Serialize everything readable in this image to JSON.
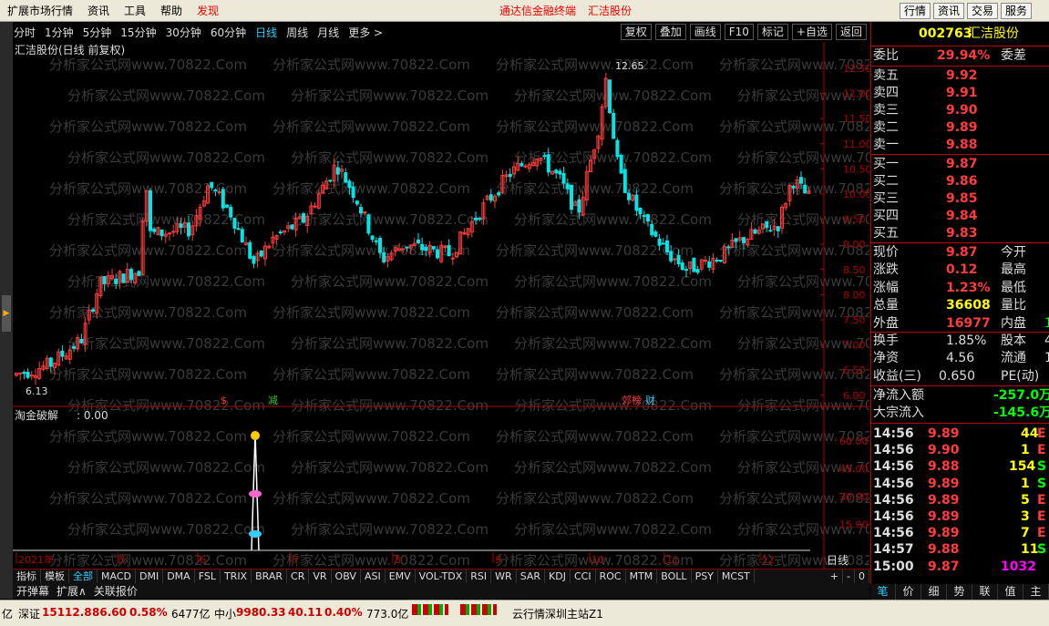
{
  "menubar": {
    "items": [
      "扩展市场行情",
      "资讯",
      "工具",
      "帮助",
      "发现"
    ],
    "center_app": "通达信金融终端",
    "center_stock": "汇洁股份",
    "right_buttons": [
      "行情",
      "资讯",
      "交易",
      "服务"
    ]
  },
  "periods": [
    "分时",
    "1分钟",
    "5分钟",
    "15分钟",
    "30分钟",
    "60分钟",
    "日线",
    "周线",
    "月线",
    "更多 >"
  ],
  "active_period": "日线",
  "tools": [
    "复权",
    "叠加",
    "画线",
    "F10",
    "标记",
    "+自选",
    "返回"
  ],
  "chart": {
    "title": "汇洁股份(日线 前复权)",
    "y_ticks": [
      "12.50",
      "12.00",
      "11.50",
      "11.00",
      "10.50",
      "10.00",
      "9.50",
      "9.00",
      "8.50",
      "8.00",
      "7.50",
      "7.00",
      "6.50",
      "6.00"
    ],
    "high_label": "12.65",
    "low_label": "6.13",
    "markers": [
      "$",
      "减",
      "郊榜",
      "财"
    ],
    "watermark": "分析家公式网www.70822.Com",
    "colors": {
      "up": "#ff3c3c",
      "down": "#00e5e5",
      "axis": "#b00000"
    }
  },
  "indicator": {
    "title": "淘金破解",
    "value": ": 0.00",
    "y_ticks": [
      "60.00",
      "45.00",
      "30.00",
      "15.00"
    ],
    "x_labels": [
      "2021年",
      "5",
      "6",
      "7",
      "8",
      "9",
      "10",
      "11",
      "12"
    ],
    "period_label": "日线"
  },
  "btabs": [
    "指标",
    "模板",
    "全部",
    "MACD",
    "DMI",
    "DMA",
    "FSL",
    "TRIX",
    "BRAR",
    "CR",
    "VR",
    "OBV",
    "ASI",
    "EMV",
    "VOL-TDX",
    "RSI",
    "WR",
    "SAR",
    "KDJ",
    "CCI",
    "ROC",
    "MTM",
    "BOLL",
    "PSY",
    "MCST"
  ],
  "btabs_active": "全部",
  "btabs_right": [
    "+",
    "-",
    "0"
  ],
  "btabs2": [
    "开弹幕",
    "扩展∧",
    "关联报价"
  ],
  "quote": {
    "code": "002763",
    "name": "汇洁股份",
    "weibi_label": "委比",
    "weibi": "29.94%",
    "weicha_label": "委差",
    "asks": [
      {
        "l": "卖五",
        "v": "9.92"
      },
      {
        "l": "卖四",
        "v": "9.91"
      },
      {
        "l": "卖三",
        "v": "9.90"
      },
      {
        "l": "卖二",
        "v": "9.89"
      },
      {
        "l": "卖一",
        "v": "9.88"
      }
    ],
    "bids": [
      {
        "l": "买一",
        "v": "9.87"
      },
      {
        "l": "买二",
        "v": "9.86"
      },
      {
        "l": "买三",
        "v": "9.85"
      },
      {
        "l": "买四",
        "v": "9.84"
      },
      {
        "l": "买五",
        "v": "9.83"
      }
    ],
    "stats": [
      {
        "l": "现价",
        "v": "9.87",
        "r": "今开"
      },
      {
        "l": "涨跌",
        "v": "0.12",
        "r": "最高"
      },
      {
        "l": "涨幅",
        "v": "1.23%",
        "r": "最低"
      },
      {
        "l": "总量",
        "v": "36608",
        "r": "量比"
      },
      {
        "l": "外盘",
        "v": "16977",
        "r": "内盘",
        "x": "1"
      }
    ],
    "stats2": [
      {
        "l": "换手",
        "v": "1.85%",
        "r": "股本",
        "x": "4"
      },
      {
        "l": "净资",
        "v": "4.56",
        "r": "流通",
        "x": "1"
      },
      {
        "l": "收益(三)",
        "v": "0.650",
        "r": "PE(动)"
      }
    ],
    "flows": [
      {
        "l": "净流入额",
        "v": "-257.0万"
      },
      {
        "l": "大宗流入",
        "v": "-145.6万"
      }
    ],
    "ticks": [
      {
        "t": "14:56",
        "p": "9.89",
        "v": "44",
        "s": "E"
      },
      {
        "t": "14:56",
        "p": "9.90",
        "v": "1",
        "s": "E"
      },
      {
        "t": "14:56",
        "p": "9.88",
        "v": "154",
        "s": "S"
      },
      {
        "t": "14:56",
        "p": "9.89",
        "v": "1",
        "s": "S"
      },
      {
        "t": "14:56",
        "p": "9.89",
        "v": "5",
        "s": "E"
      },
      {
        "t": "14:56",
        "p": "9.89",
        "v": "3",
        "s": "E"
      },
      {
        "t": "14:56",
        "p": "9.89",
        "v": "7",
        "s": "E"
      },
      {
        "t": "14:57",
        "p": "9.88",
        "v": "11",
        "s": "S"
      },
      {
        "t": "15:00",
        "p": "9.87",
        "v": "1032",
        "s": ""
      }
    ]
  },
  "rtabs": [
    "笔",
    "价",
    "细",
    "势",
    "联",
    "值",
    "主"
  ],
  "status": {
    "a": "亿",
    "b": "深证",
    "c": "15112.8",
    "d": "86.60",
    "e": "0.58%",
    "f": "6477亿",
    "g": "中小",
    "h": "9980.33",
    "i": "40.11",
    "j": "0.40%",
    "k": "773.0亿",
    "l": "云行情深圳主站Z1"
  }
}
